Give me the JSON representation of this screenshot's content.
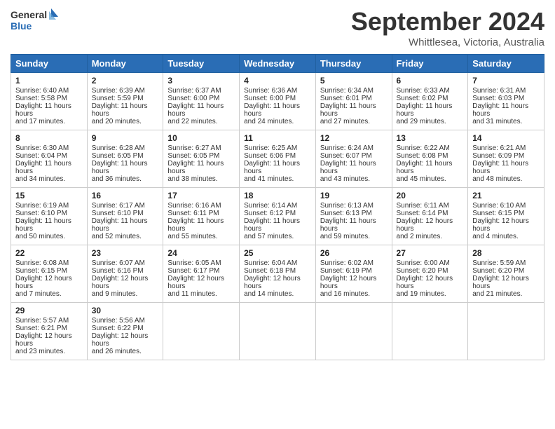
{
  "header": {
    "logo_line1": "General",
    "logo_line2": "Blue",
    "month": "September 2024",
    "location": "Whittlesea, Victoria, Australia"
  },
  "weekdays": [
    "Sunday",
    "Monday",
    "Tuesday",
    "Wednesday",
    "Thursday",
    "Friday",
    "Saturday"
  ],
  "weeks": [
    [
      {
        "day": "1",
        "rise": "6:40 AM",
        "set": "5:58 PM",
        "daylight": "11 hours and 17 minutes."
      },
      {
        "day": "2",
        "rise": "6:39 AM",
        "set": "5:59 PM",
        "daylight": "11 hours and 20 minutes."
      },
      {
        "day": "3",
        "rise": "6:37 AM",
        "set": "6:00 PM",
        "daylight": "11 hours and 22 minutes."
      },
      {
        "day": "4",
        "rise": "6:36 AM",
        "set": "6:00 PM",
        "daylight": "11 hours and 24 minutes."
      },
      {
        "day": "5",
        "rise": "6:34 AM",
        "set": "6:01 PM",
        "daylight": "11 hours and 27 minutes."
      },
      {
        "day": "6",
        "rise": "6:33 AM",
        "set": "6:02 PM",
        "daylight": "11 hours and 29 minutes."
      },
      {
        "day": "7",
        "rise": "6:31 AM",
        "set": "6:03 PM",
        "daylight": "11 hours and 31 minutes."
      }
    ],
    [
      {
        "day": "8",
        "rise": "6:30 AM",
        "set": "6:04 PM",
        "daylight": "11 hours and 34 minutes."
      },
      {
        "day": "9",
        "rise": "6:28 AM",
        "set": "6:05 PM",
        "daylight": "11 hours and 36 minutes."
      },
      {
        "day": "10",
        "rise": "6:27 AM",
        "set": "6:05 PM",
        "daylight": "11 hours and 38 minutes."
      },
      {
        "day": "11",
        "rise": "6:25 AM",
        "set": "6:06 PM",
        "daylight": "11 hours and 41 minutes."
      },
      {
        "day": "12",
        "rise": "6:24 AM",
        "set": "6:07 PM",
        "daylight": "11 hours and 43 minutes."
      },
      {
        "day": "13",
        "rise": "6:22 AM",
        "set": "6:08 PM",
        "daylight": "11 hours and 45 minutes."
      },
      {
        "day": "14",
        "rise": "6:21 AM",
        "set": "6:09 PM",
        "daylight": "11 hours and 48 minutes."
      }
    ],
    [
      {
        "day": "15",
        "rise": "6:19 AM",
        "set": "6:10 PM",
        "daylight": "11 hours and 50 minutes."
      },
      {
        "day": "16",
        "rise": "6:17 AM",
        "set": "6:10 PM",
        "daylight": "11 hours and 52 minutes."
      },
      {
        "day": "17",
        "rise": "6:16 AM",
        "set": "6:11 PM",
        "daylight": "11 hours and 55 minutes."
      },
      {
        "day": "18",
        "rise": "6:14 AM",
        "set": "6:12 PM",
        "daylight": "11 hours and 57 minutes."
      },
      {
        "day": "19",
        "rise": "6:13 AM",
        "set": "6:13 PM",
        "daylight": "11 hours and 59 minutes."
      },
      {
        "day": "20",
        "rise": "6:11 AM",
        "set": "6:14 PM",
        "daylight": "12 hours and 2 minutes."
      },
      {
        "day": "21",
        "rise": "6:10 AM",
        "set": "6:15 PM",
        "daylight": "12 hours and 4 minutes."
      }
    ],
    [
      {
        "day": "22",
        "rise": "6:08 AM",
        "set": "6:15 PM",
        "daylight": "12 hours and 7 minutes."
      },
      {
        "day": "23",
        "rise": "6:07 AM",
        "set": "6:16 PM",
        "daylight": "12 hours and 9 minutes."
      },
      {
        "day": "24",
        "rise": "6:05 AM",
        "set": "6:17 PM",
        "daylight": "12 hours and 11 minutes."
      },
      {
        "day": "25",
        "rise": "6:04 AM",
        "set": "6:18 PM",
        "daylight": "12 hours and 14 minutes."
      },
      {
        "day": "26",
        "rise": "6:02 AM",
        "set": "6:19 PM",
        "daylight": "12 hours and 16 minutes."
      },
      {
        "day": "27",
        "rise": "6:00 AM",
        "set": "6:20 PM",
        "daylight": "12 hours and 19 minutes."
      },
      {
        "day": "28",
        "rise": "5:59 AM",
        "set": "6:20 PM",
        "daylight": "12 hours and 21 minutes."
      }
    ],
    [
      {
        "day": "29",
        "rise": "5:57 AM",
        "set": "6:21 PM",
        "daylight": "12 hours and 23 minutes."
      },
      {
        "day": "30",
        "rise": "5:56 AM",
        "set": "6:22 PM",
        "daylight": "12 hours and 26 minutes."
      },
      null,
      null,
      null,
      null,
      null
    ]
  ],
  "labels": {
    "sunrise": "Sunrise:",
    "sunset": "Sunset:",
    "daylight": "Daylight:"
  }
}
